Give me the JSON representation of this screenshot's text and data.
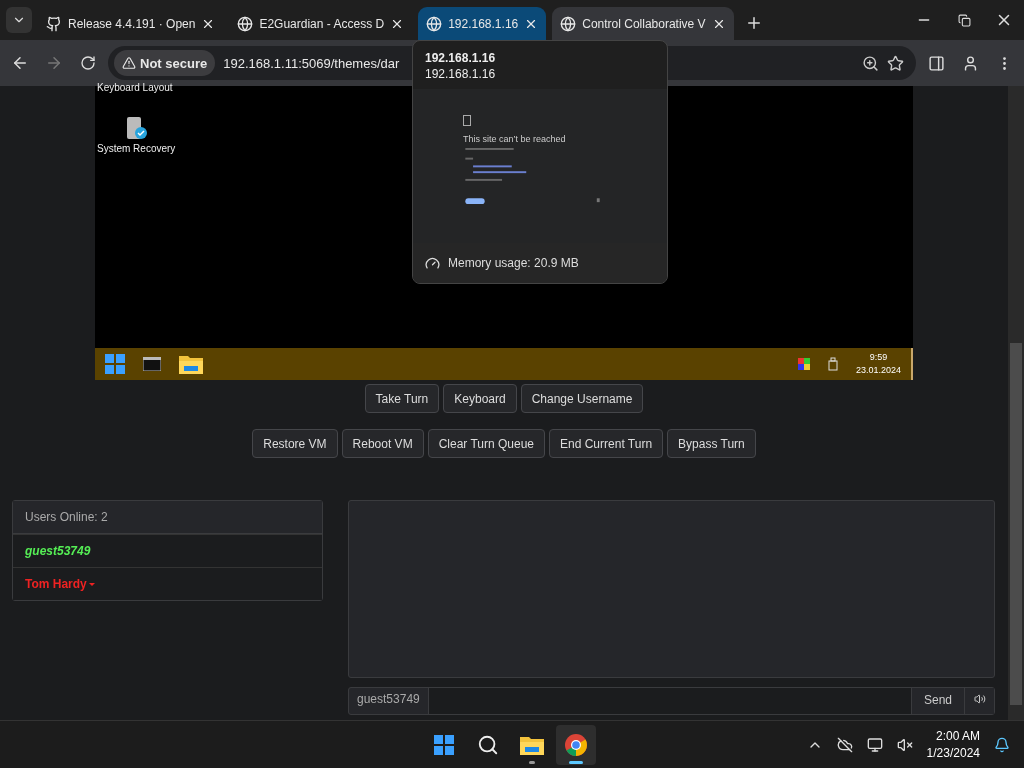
{
  "browser": {
    "tabs": [
      {
        "title": "Release 4.4.191 · Open",
        "kind": "github",
        "selected": false,
        "hovered": false
      },
      {
        "title": "E2Guardian - Access D",
        "kind": "site",
        "selected": false,
        "hovered": false
      },
      {
        "title": "192.168.1.16",
        "kind": "site",
        "selected": false,
        "hovered": true
      },
      {
        "title": "Control Collaborative V",
        "kind": "site",
        "selected": true,
        "hovered": false
      }
    ],
    "security": "Not secure",
    "url": "192.168.1.11:5069/themes/dar"
  },
  "tab_preview": {
    "title": "192.168.1.16",
    "url": "192.168.1.16",
    "page_heading": "This site can’t be reached",
    "memory": "Memory usage: 20.9 MB"
  },
  "vm": {
    "desktop_icons": [
      {
        "label": "Keyboard Layout",
        "kind": "cut"
      },
      {
        "label": "System Recovery",
        "kind": "recovery"
      }
    ],
    "time": "9:59",
    "date": "23.01.2024"
  },
  "button_rows": [
    [
      "Take Turn",
      "Keyboard",
      "Change Username"
    ],
    [
      "Restore VM",
      "Reboot VM",
      "Clear Turn Queue",
      "End Current Turn",
      "Bypass Turn"
    ]
  ],
  "users": {
    "header": "Users Online: 2",
    "list": [
      {
        "name": "guest53749",
        "kind": "guest",
        "color": "#55ee55"
      },
      {
        "name": "Tom Hardy",
        "kind": "admin",
        "color": "#ee2222"
      }
    ]
  },
  "chat": {
    "username": "guest53749",
    "send": "Send"
  },
  "taskbar": {
    "apps": [
      {
        "kind": "start",
        "selected": false
      },
      {
        "kind": "search",
        "selected": false
      },
      {
        "kind": "files",
        "selected": false
      },
      {
        "kind": "chrome",
        "selected": true
      }
    ],
    "time": "2:00 AM",
    "date": "1/23/2024"
  }
}
